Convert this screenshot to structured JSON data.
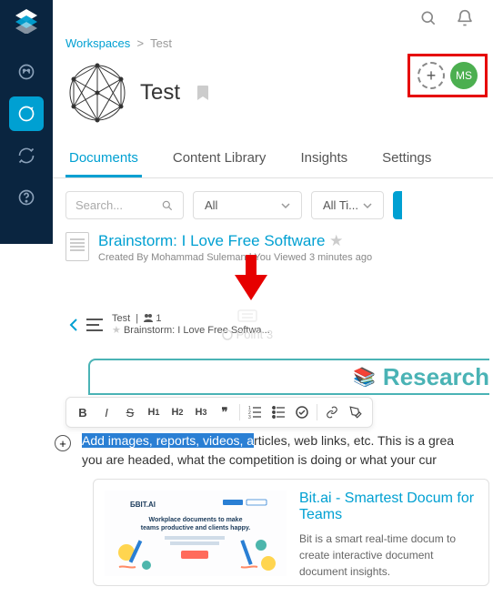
{
  "breadcrumb": {
    "root": "Workspaces",
    "sep": ">",
    "current": "Test"
  },
  "workspace": {
    "title": "Test"
  },
  "avatar": {
    "initials": "MS"
  },
  "tabs": {
    "documents": "Documents",
    "library": "Content Library",
    "insights": "Insights",
    "settings": "Settings"
  },
  "filters": {
    "search_placeholder": "Search...",
    "type": "All",
    "time": "All Ti..."
  },
  "doc": {
    "title": "Brainstorm: I Love Free Software",
    "meta": "Created By Mohammad Suleman  |  You Viewed 3 minutes ago"
  },
  "editor": {
    "crumb": "Test",
    "members": "1",
    "title": "Brainstorm: I Love Free Softwa..."
  },
  "phantom": {
    "label": "Point 3"
  },
  "research": {
    "heading": "Research"
  },
  "body": {
    "highlighted": "Add images, reports, videos, a",
    "rest1": "rticles, web links, etc. This is a grea",
    "line2": "you are headed, what the competition is doing or what your cur"
  },
  "card": {
    "brand": "ƂBIT.AI",
    "tagline": "Workplace documents to make teams productive and clients happy.",
    "title": "Bit.ai - Smartest Docum for Teams",
    "desc": "Bit is a smart real-time docum to create interactive document document insights."
  }
}
